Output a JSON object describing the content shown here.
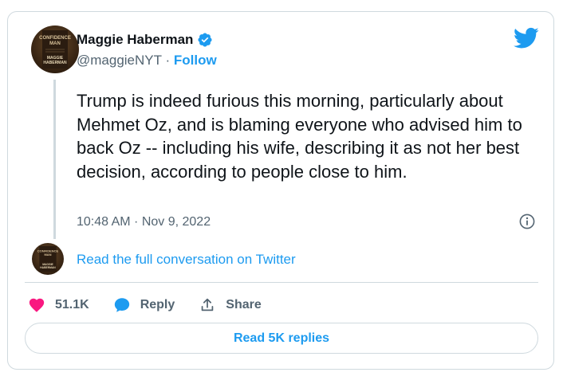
{
  "author": {
    "name": "Maggie Haberman",
    "handle": "@maggieNYT",
    "separator": "·",
    "follow_label": "Follow",
    "avatar_text_top": "CONFIDENCE",
    "avatar_text_mid": "MAN",
    "avatar_text_bottom": "MAGGIE",
    "avatar_text_last": "HABERMAN"
  },
  "tweet": {
    "text": "Trump is indeed furious this morning, particularly about Mehmet Oz, and is blaming everyone who advised him to back Oz -- including his wife, describing it as not her best decision, according to people close to him.",
    "timestamp": "10:48 AM · Nov 9, 2022"
  },
  "thread": {
    "read_conversation": "Read the full conversation on Twitter"
  },
  "actions": {
    "like_count": "51.1K",
    "reply_label": "Reply",
    "share_label": "Share"
  },
  "footer": {
    "read_replies": "Read 5K replies"
  },
  "colors": {
    "accent": "#1d9bf0",
    "heart": "#f91880",
    "muted": "#536471",
    "border": "#cfd9de"
  },
  "icons": [
    "verified-badge-icon",
    "twitter-bird-icon",
    "info-icon",
    "heart-icon",
    "reply-bubble-icon",
    "share-upload-icon"
  ]
}
